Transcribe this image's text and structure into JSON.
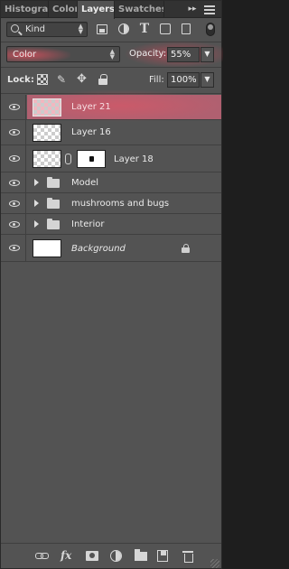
{
  "tabs": [
    {
      "label": "Histogram",
      "active": false
    },
    {
      "label": "Color",
      "active": false
    },
    {
      "label": "Layers",
      "active": true
    },
    {
      "label": "Swatches",
      "active": false
    }
  ],
  "tab_overflow": "▸▸",
  "filter": {
    "kind_label": "Kind",
    "filter_icons": [
      "pixel-layer-filter-icon",
      "adjustment-layer-filter-icon",
      "type-layer-filter-icon",
      "shape-layer-filter-icon",
      "smart-object-filter-icon"
    ]
  },
  "blend": {
    "mode": "Color",
    "opacity_label": "Opacity:",
    "opacity_value": "55%"
  },
  "lock": {
    "label": "Lock:",
    "fill_label": "Fill:",
    "fill_value": "100%"
  },
  "layers": [
    {
      "name": "Layer 21",
      "type": "pixel",
      "visible": true,
      "selected": true
    },
    {
      "name": "Layer 16",
      "type": "pixel",
      "visible": true,
      "selected": false
    },
    {
      "name": "Layer 18",
      "type": "pixel-with-mask",
      "visible": true,
      "selected": false
    },
    {
      "name": "Model",
      "type": "group",
      "visible": true,
      "selected": false
    },
    {
      "name": "mushrooms and bugs",
      "type": "group",
      "visible": true,
      "selected": false
    },
    {
      "name": "Interior",
      "type": "group",
      "visible": true,
      "selected": false
    },
    {
      "name": "Background",
      "type": "background",
      "visible": true,
      "locked": true,
      "selected": false
    }
  ],
  "footer_icons": [
    "link-layers-icon",
    "fx-icon",
    "add-mask-icon",
    "new-adjustment-icon",
    "new-group-icon",
    "new-layer-icon",
    "delete-layer-icon"
  ],
  "colors": {
    "panel_bg": "#535353",
    "selected_layer": "#b06070",
    "highlight_glow": "#e6465a"
  }
}
